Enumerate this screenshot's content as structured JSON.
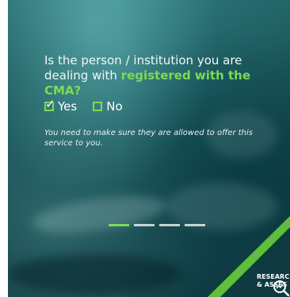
{
  "question": {
    "prefix": "Is the person / institution you are dealing with ",
    "highlight": "registered with the CMA?"
  },
  "options": {
    "yes_label": "Yes",
    "yes_checked": true,
    "no_label": "No",
    "no_checked": false,
    "check_glyph": "✓"
  },
  "note": "You need to make sure they are allowed to offer this service to you.",
  "carousel": {
    "slide_count": 4,
    "active_index": 0
  },
  "corner": {
    "label": "RESEARC\n& ASSES",
    "icon": "magnifier-chart-icon"
  },
  "colors": {
    "accent": "#7ed957",
    "corner_green": "#5fbf3a",
    "corner_dark": "#0e3a40",
    "text": "#ffffff"
  }
}
